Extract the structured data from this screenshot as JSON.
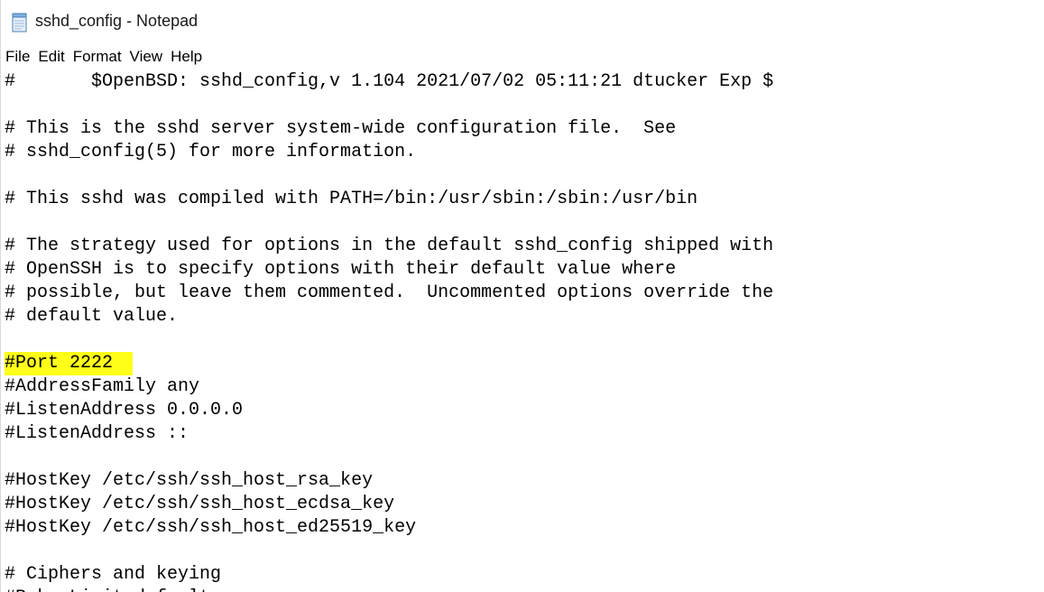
{
  "window": {
    "title": "sshd_config - Notepad",
    "icon": "notepad-icon"
  },
  "menu": [
    "File",
    "Edit",
    "Format",
    "View",
    "Help"
  ],
  "editor": {
    "highlight_color": "#ffff1a",
    "highlighted_line_index": 12,
    "lines": [
      "#\t$OpenBSD: sshd_config,v 1.104 2021/07/02 05:11:21 dtucker Exp $",
      "",
      "# This is the sshd server system-wide configuration file.  See",
      "# sshd_config(5) for more information.",
      "",
      "# This sshd was compiled with PATH=/bin:/usr/sbin:/sbin:/usr/bin",
      "",
      "# The strategy used for options in the default sshd_config shipped with",
      "# OpenSSH is to specify options with their default value where",
      "# possible, but leave them commented.  Uncommented options override the",
      "# default value.",
      "",
      "#Port 2222",
      "#AddressFamily any",
      "#ListenAddress 0.0.0.0",
      "#ListenAddress ::",
      "",
      "#HostKey /etc/ssh/ssh_host_rsa_key",
      "#HostKey /etc/ssh/ssh_host_ecdsa_key",
      "#HostKey /etc/ssh/ssh_host_ed25519_key",
      "",
      "# Ciphers and keying",
      "#RekeyLimit default none"
    ]
  }
}
